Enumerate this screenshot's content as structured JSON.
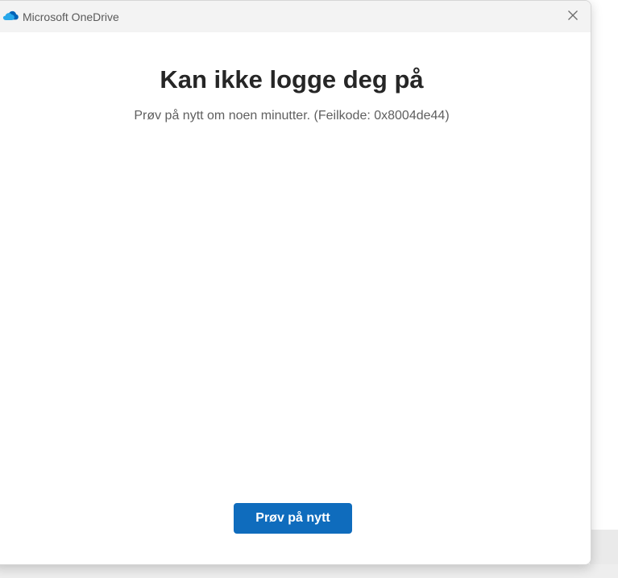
{
  "window": {
    "app_title": "Microsoft OneDrive",
    "app_icon": "onedrive-cloud-icon",
    "close_icon": "close-icon"
  },
  "content": {
    "heading": "Kan ikke logge deg på",
    "message": "Prøv på nytt om noen minutter. (Feilkode: 0x8004de44)",
    "retry_label": "Prøv på nytt"
  },
  "colors": {
    "accent": "#0f6cbd",
    "onedrive_cloud_light": "#28a8ea",
    "onedrive_cloud_dark": "#0364b8",
    "titlebar_bg": "#f3f3f3"
  }
}
